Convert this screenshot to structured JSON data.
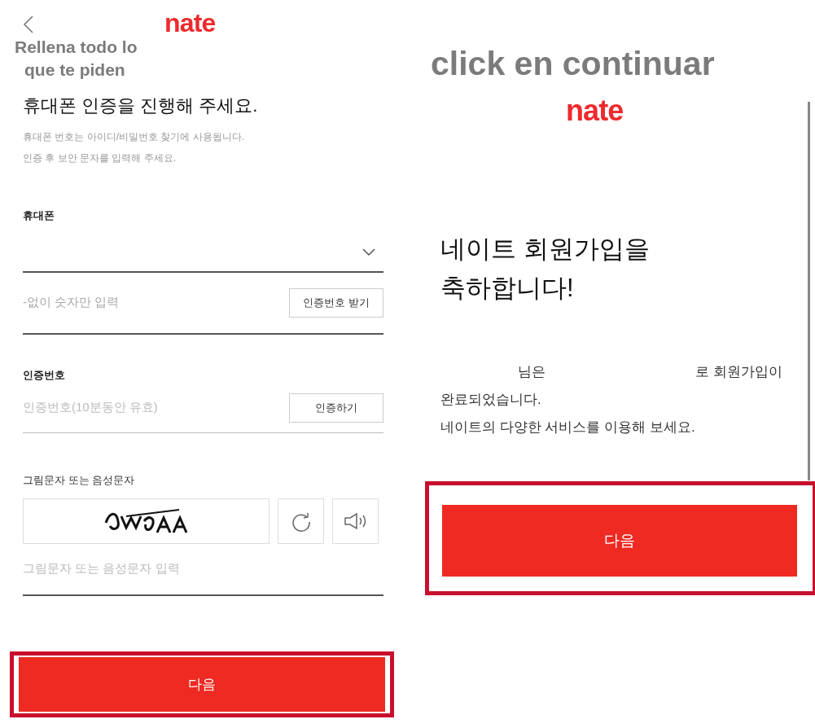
{
  "left_screen": {
    "logo": "nate",
    "annotation": [
      "Rellena todo lo",
      "que te piden"
    ],
    "title": "휴대폰 인증을 진행해 주세요.",
    "description": [
      "휴대폰 번호는 아이디/비밀번호 찾기에 사용됩니다.",
      "인증 후 보안 문자를 입력해 주세요."
    ],
    "phone": {
      "label": "휴대폰",
      "placeholder": "-없이 숫자만 입력",
      "button": "인증번호 받기"
    },
    "code": {
      "label": "인증번호",
      "placeholder": "인증번호(10분동안 유효)",
      "button": "인증하기"
    },
    "captcha": {
      "label": "그림문자 또는 음성문자",
      "placeholder": "그림문자 또는 음성문자 입력"
    },
    "next_button": "다음"
  },
  "right_screen": {
    "annotation": "click en continuar",
    "logo": "nate",
    "heading": [
      "네이트 회원가입을",
      "축하합니다!"
    ],
    "message_parts": [
      "님은",
      "로 회원가입이"
    ],
    "message_lines": [
      "완료되었습니다.",
      "네이트의 다양한 서비스를 이용해 보세요."
    ],
    "next_button": "다음"
  }
}
